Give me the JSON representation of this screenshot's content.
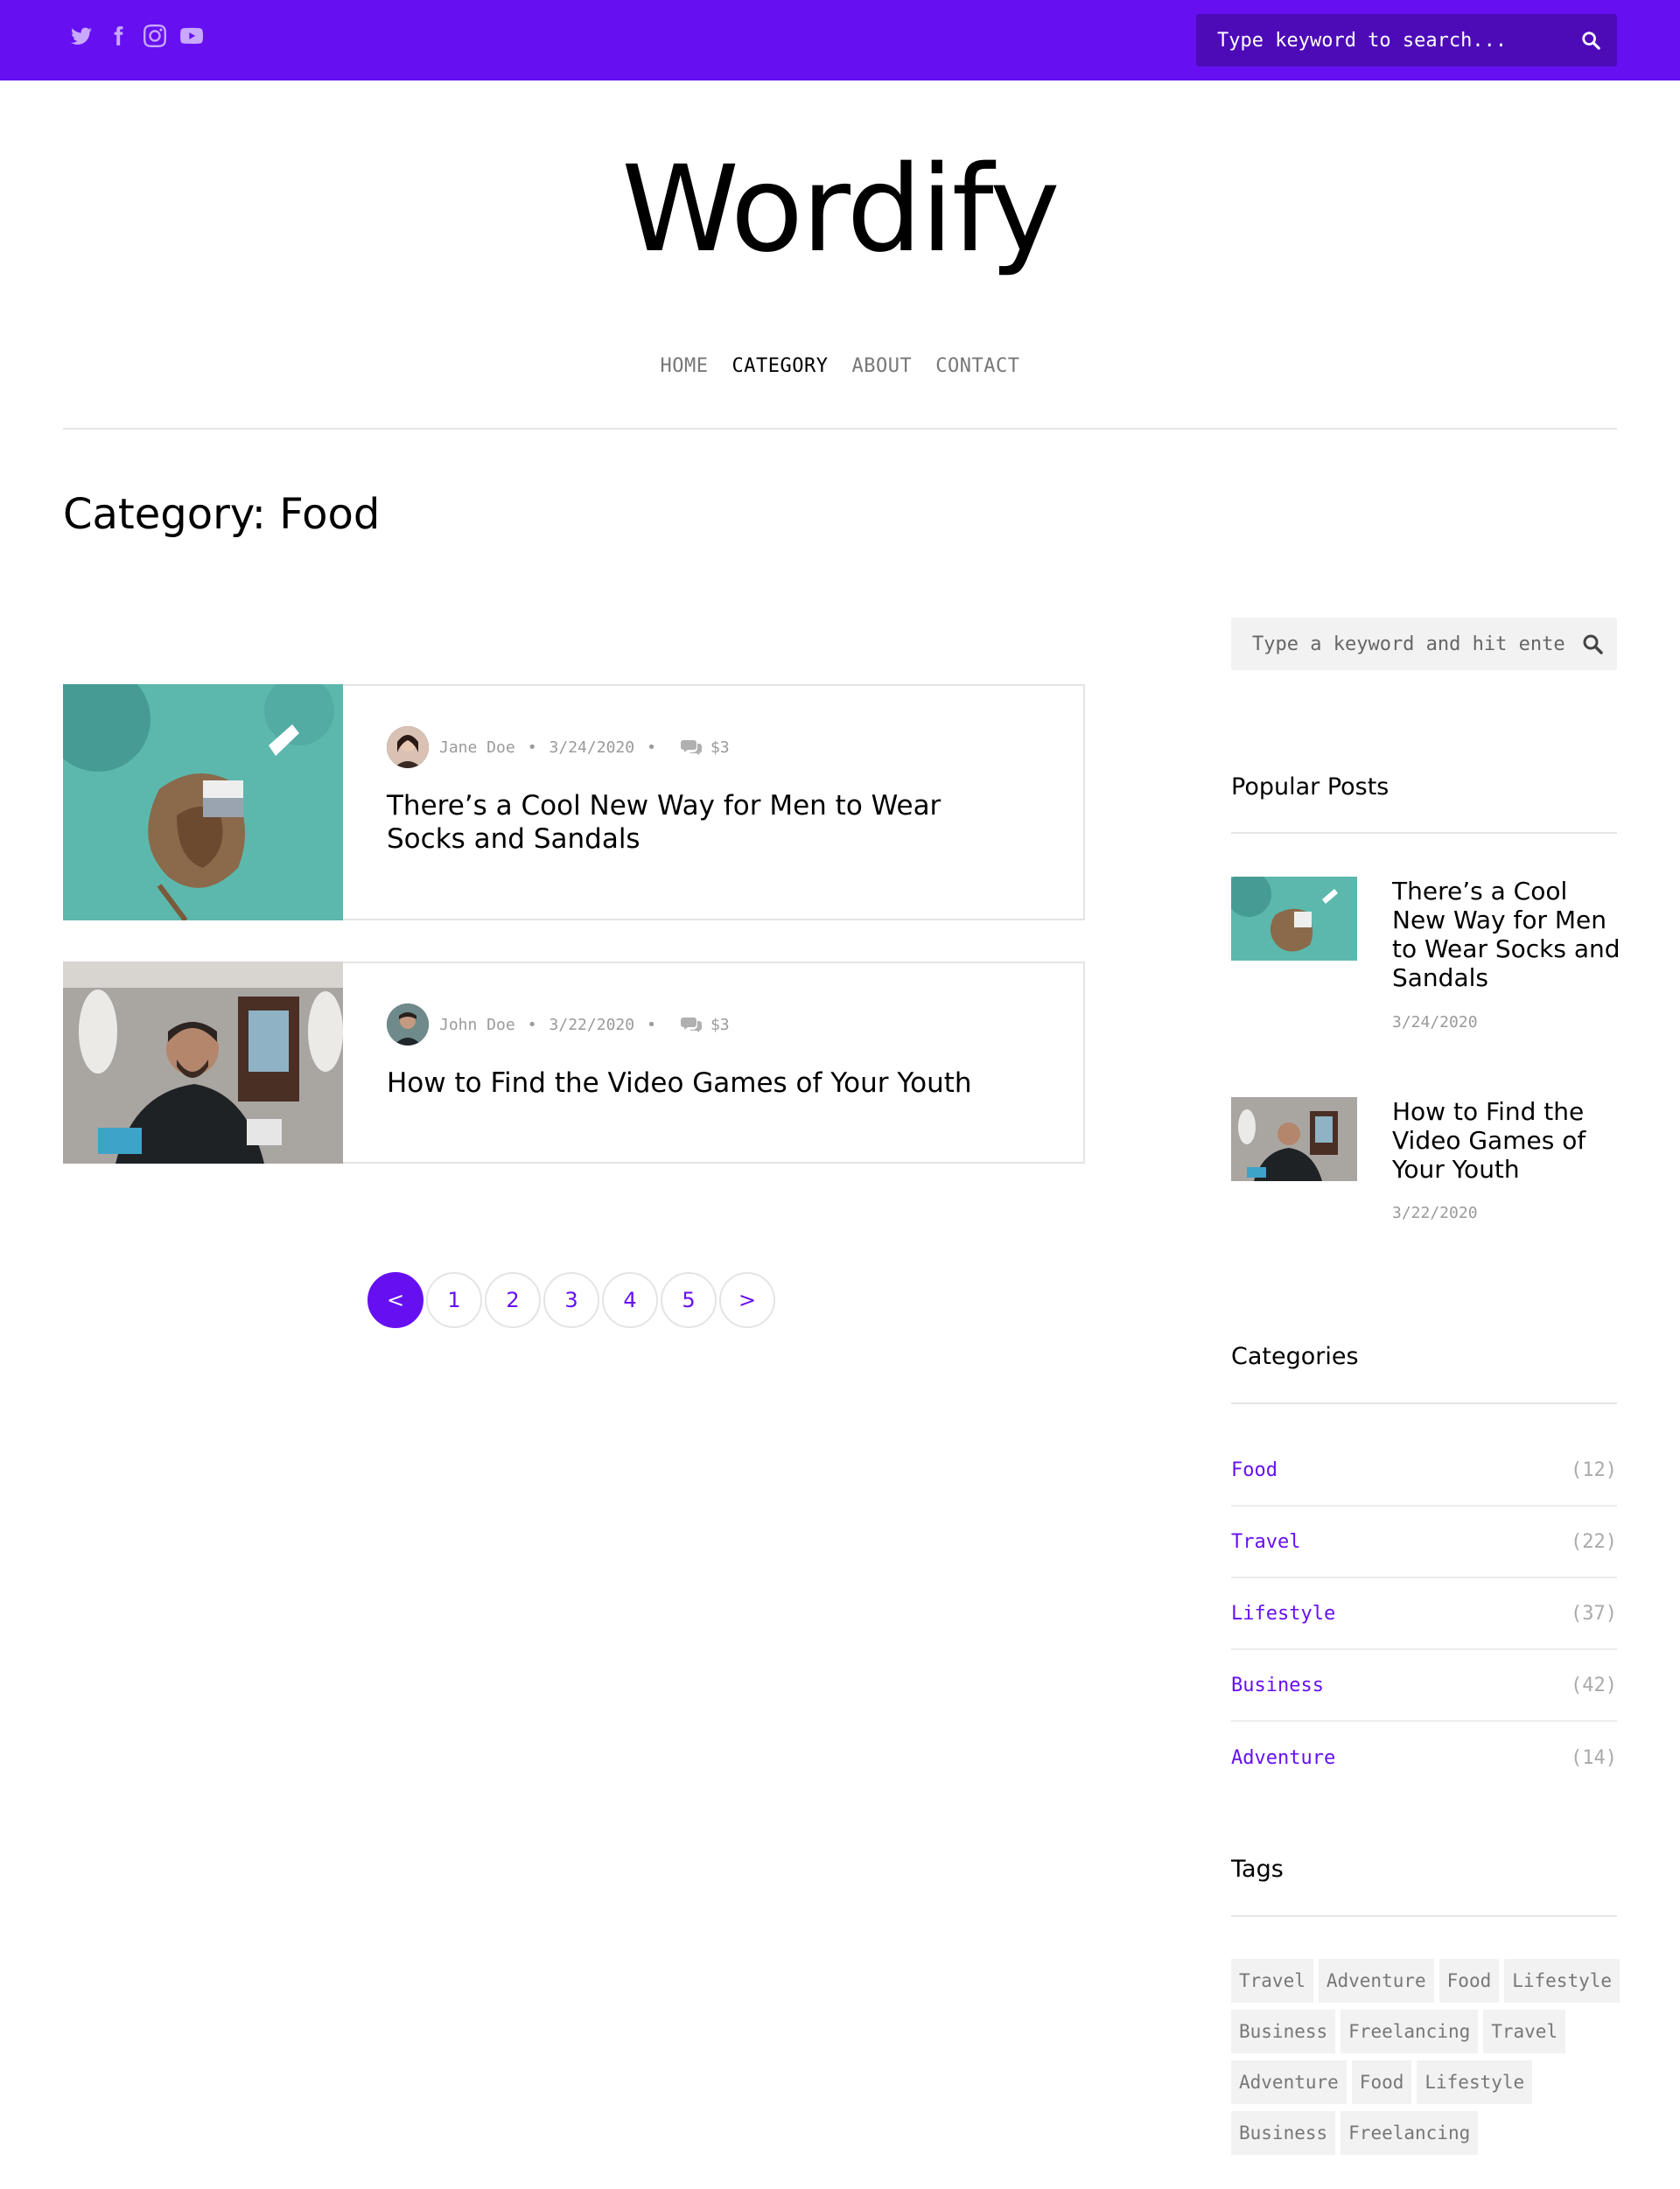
{
  "topbar": {
    "social_icons": [
      "twitter-icon",
      "facebook-icon",
      "instagram-icon",
      "youtube-icon"
    ],
    "search_placeholder": "Type keyword to search..."
  },
  "site": {
    "logo": "Wordify"
  },
  "nav": [
    {
      "label": "HOME",
      "active": false
    },
    {
      "label": "CATEGORY",
      "active": true
    },
    {
      "label": "ABOUT",
      "active": false
    },
    {
      "label": "CONTACT",
      "active": false
    }
  ],
  "page": {
    "title": "Category: Food"
  },
  "posts": [
    {
      "author": "Jane Doe",
      "date": "3/24/2020",
      "comments": "$3",
      "title": "There’s a Cool New Way for Men to Wear Socks and Sandals"
    },
    {
      "author": "John Doe",
      "date": "3/22/2020",
      "comments": "$3",
      "title": "How to Find the Video Games of Your Youth"
    }
  ],
  "pagination": {
    "prev": "<",
    "pages": [
      "1",
      "2",
      "3",
      "4",
      "5"
    ],
    "next": ">"
  },
  "sidebar": {
    "search_placeholder": "Type a keyword and hit enter",
    "popular_heading": "Popular Posts",
    "popular": [
      {
        "title": "There’s a Cool New Way for Men to Wear Socks and Sandals",
        "date": "3/24/2020"
      },
      {
        "title": "How to Find the Video Games of Your Youth",
        "date": "3/22/2020"
      }
    ],
    "categories_heading": "Categories",
    "categories": [
      {
        "name": "Food",
        "count": "(12)"
      },
      {
        "name": "Travel",
        "count": "(22)"
      },
      {
        "name": "Lifestyle",
        "count": "(37)"
      },
      {
        "name": "Business",
        "count": "(42)"
      },
      {
        "name": "Adventure",
        "count": "(14)"
      }
    ],
    "tags_heading": "Tags",
    "tags": [
      "Travel",
      "Adventure",
      "Food",
      "Lifestyle",
      "Business",
      "Freelancing",
      "Travel",
      "Adventure",
      "Food",
      "Lifestyle",
      "Business",
      "Freelancing"
    ]
  },
  "colors": {
    "accent": "#6610f2",
    "muted": "#9a9a9a"
  }
}
